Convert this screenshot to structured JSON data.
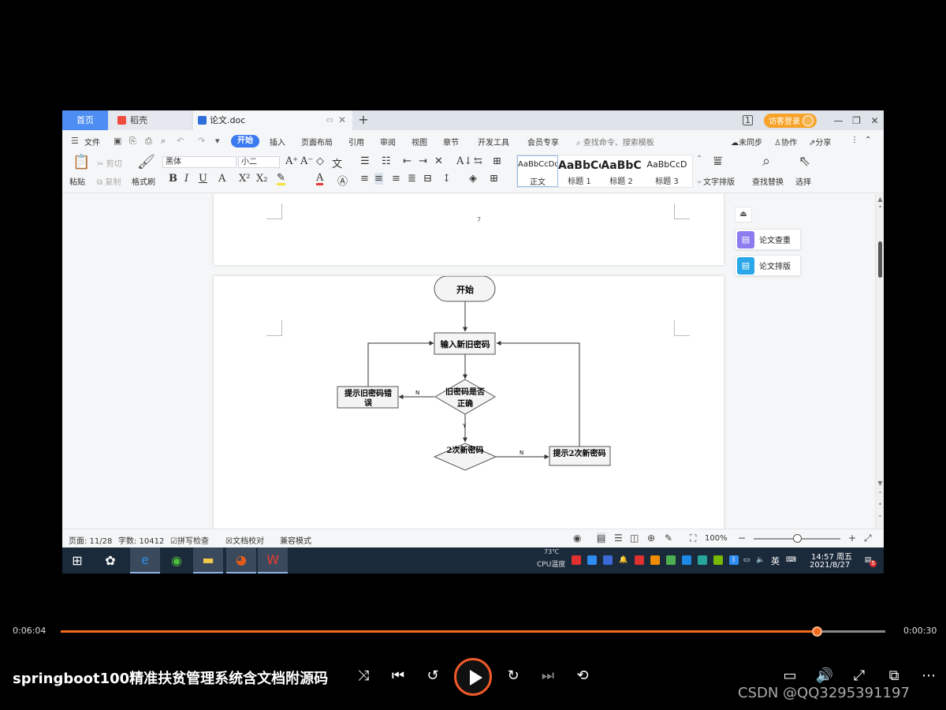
{
  "tabs": {
    "home": "首页",
    "docer": "稻壳",
    "document": "论文.doc",
    "add": "+"
  },
  "window": {
    "login": "访客登录",
    "minimize": "—",
    "restore": "❐",
    "close": "✕"
  },
  "menu": {
    "file": "文件",
    "start": "开始",
    "insert": "插入",
    "layout": "页面布局",
    "references": "引用",
    "review": "审阅",
    "view": "视图",
    "chapter": "章节",
    "dev": "开发工具",
    "member": "会员专享",
    "search": "查找命令、搜索模板",
    "unsync": "未同步",
    "collab": "协作",
    "share": "分享"
  },
  "ribbon": {
    "paste": "粘贴",
    "cut": "剪切",
    "copy": "复制",
    "format_painter": "格式刷",
    "font": "黑体",
    "size": "小二",
    "styles": [
      {
        "sample": "AaBbCcDd",
        "name": "正文"
      },
      {
        "sample": "AaBbCc",
        "name": "标题 1"
      },
      {
        "sample": "AaBbC",
        "name": "标题 2"
      },
      {
        "sample": "AaBbCcD",
        "name": "标题 3"
      }
    ],
    "text_layout": "文字排版",
    "find_replace": "查找替换",
    "select": "选择"
  },
  "document": {
    "page_number": "7",
    "flowchart": {
      "start": "开始",
      "input": "输入新旧密码",
      "check_old_1": "旧密码是否",
      "check_old_2": "正确",
      "error_old_1": "提示旧密码错",
      "error_old_2": "误",
      "check_new": "2次新密码",
      "error_new": "提示2次新密码",
      "label_n1": "N",
      "label_y": "Y",
      "label_n2": "N"
    }
  },
  "side_panel": {
    "check": "论文查重",
    "format": "论文排版"
  },
  "status": {
    "page": "页面: 11/28",
    "words": "字数: 10412",
    "spell": "拼写检查",
    "proof": "文档校对",
    "compat": "兼容模式",
    "zoom": "100%"
  },
  "taskbar": {
    "cpu_temp": "73℃",
    "cpu_label": "CPU温度",
    "ime": "英",
    "time": "14:57 周五",
    "date": "2021/8/27",
    "notify_badge": "5"
  },
  "player": {
    "time_current": "0:06:04",
    "time_total": "0:00:30",
    "progress": 0.917,
    "title": "springboot100精准扶贫管理系统含文档附源码",
    "watermark": "CSDN @QQ3295391197"
  },
  "colors": {
    "accent": "#3b7af0",
    "player_accent": "#f26b1d",
    "login": "#f7a32a"
  }
}
